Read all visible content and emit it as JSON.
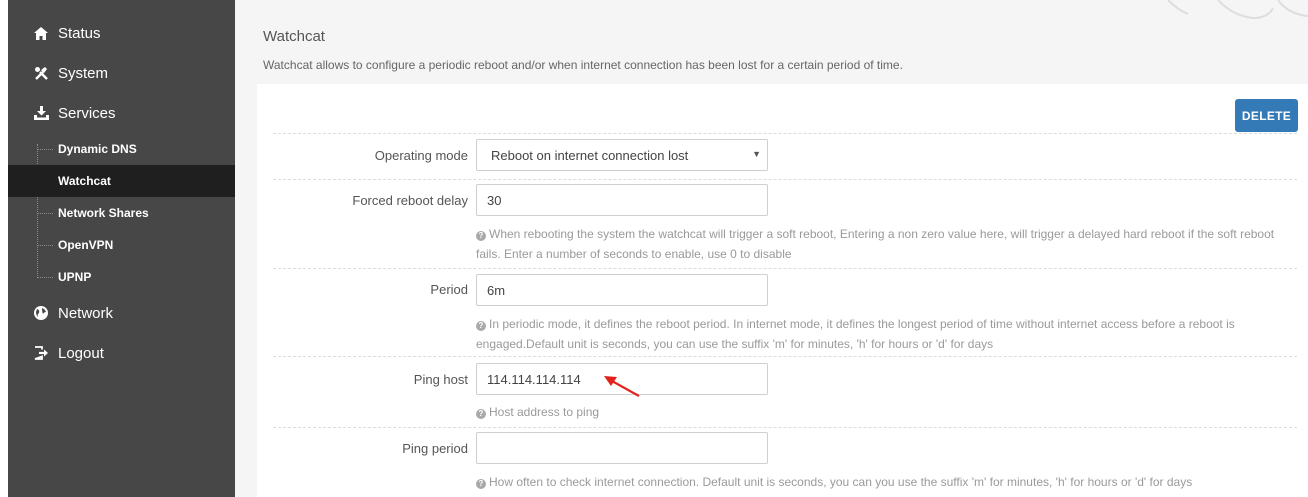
{
  "sidebar": {
    "items": [
      {
        "label": "Status",
        "icon": "home-icon"
      },
      {
        "label": "System",
        "icon": "wrench-icon"
      },
      {
        "label": "Services",
        "icon": "download-icon"
      },
      {
        "label": "Network",
        "icon": "globe-icon"
      },
      {
        "label": "Logout",
        "icon": "logout-icon"
      }
    ],
    "services_sub": [
      {
        "label": "Dynamic DNS"
      },
      {
        "label": "Watchcat",
        "active": true
      },
      {
        "label": "Network Shares"
      },
      {
        "label": "OpenVPN"
      },
      {
        "label": "UPNP"
      }
    ]
  },
  "main": {
    "title": "Watchcat",
    "description": "Watchcat allows to configure a periodic reboot and/or when internet connection has been lost for a certain period of time.",
    "delete_label": "DELETE",
    "fields": {
      "operating_mode": {
        "label": "Operating mode",
        "value": "Reboot on internet connection lost"
      },
      "forced_reboot_delay": {
        "label": "Forced reboot delay",
        "value": "30",
        "help": "When rebooting the system the watchcat will trigger a soft reboot, Entering a non zero value here, will trigger a delayed hard reboot if the soft reboot fails. Enter a number of seconds to enable, use 0 to disable"
      },
      "period": {
        "label": "Period",
        "value": "6m",
        "help": "In periodic mode, it defines the reboot period. In internet mode, it defines the longest period of time without internet access before a reboot is engaged.Default unit is seconds, you can use the suffix 'm' for minutes, 'h' for hours or 'd' for days"
      },
      "ping_host": {
        "label": "Ping host",
        "value": "114.114.114.114",
        "help": "Host address to ping"
      },
      "ping_period": {
        "label": "Ping period",
        "value": "",
        "help": "How often to check internet connection. Default unit is seconds, you can you use the suffix 'm' for minutes, 'h' for hours or 'd' for days"
      }
    }
  },
  "colors": {
    "sidebar_bg": "#474747",
    "sidebar_active": "#1f1f1f",
    "accent": "#337ab7",
    "annotation_arrow": "#e0231c"
  }
}
